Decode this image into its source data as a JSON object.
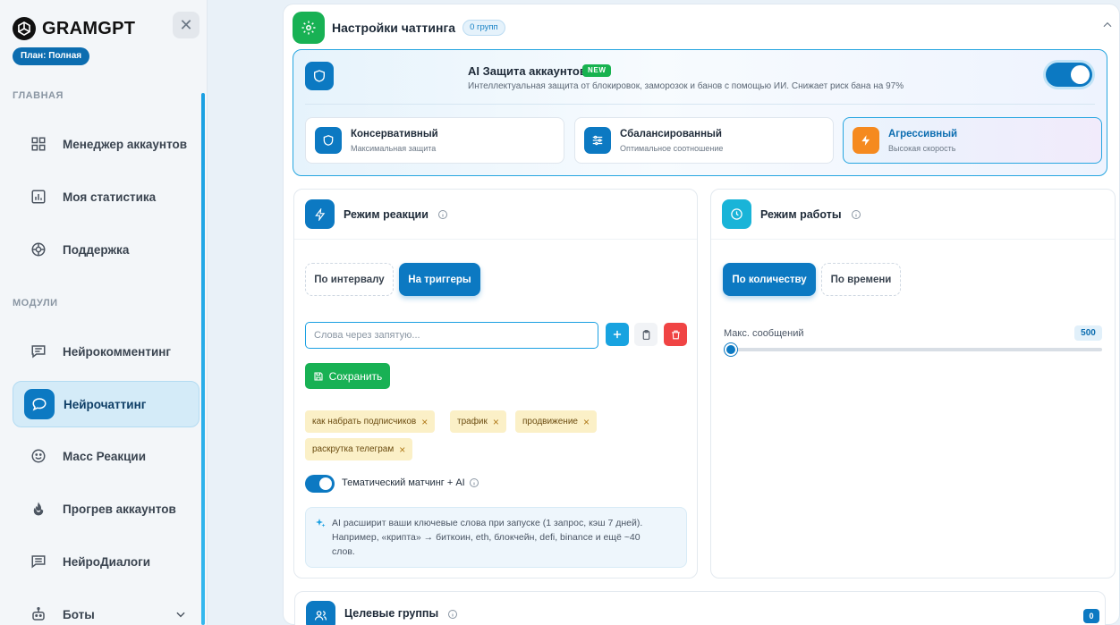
{
  "brand": {
    "name": "GRAMGPT",
    "plan": "План: Полная"
  },
  "sidebar": {
    "sections": {
      "main": "ГЛАВНАЯ",
      "modules": "МОДУЛИ"
    },
    "items": [
      {
        "label": "Менеджер аккаунтов",
        "icon": "grid-icon"
      },
      {
        "label": "Моя статистика",
        "icon": "chart-icon"
      },
      {
        "label": "Поддержка",
        "icon": "lifebuoy-icon"
      },
      {
        "label": "Нейрокомментинг",
        "icon": "comment-icon"
      },
      {
        "label": "Нейрочаттинг",
        "icon": "chat-icon",
        "active": true
      },
      {
        "label": "Масс Реакции",
        "icon": "smile-icon"
      },
      {
        "label": "Прогрев аккаунтов",
        "icon": "fire-icon"
      },
      {
        "label": "НейроДиалоги",
        "icon": "dialog-icon"
      },
      {
        "label": "Боты",
        "icon": "bot-icon"
      }
    ]
  },
  "panel": {
    "title": "Настройки чаттинга",
    "badge": "0 групп"
  },
  "ai_protection": {
    "title": "AI Защита аккаунтов",
    "new_badge": "NEW",
    "description": "Интеллектуальная защита от блокировок, заморозок и банов с помощью ИИ. Снижает риск бана на 97%",
    "enabled": true,
    "modes": [
      {
        "title": "Консервативный",
        "subtitle": "Максимальная защита",
        "color": "#0c79c2"
      },
      {
        "title": "Сбалансированный",
        "subtitle": "Оптимальное соотношение",
        "color": "#0c79c2"
      },
      {
        "title": "Агрессивный",
        "subtitle": "Высокая скорость",
        "color": "#f58a1f",
        "selected": true
      }
    ]
  },
  "reaction": {
    "title": "Режим реакции",
    "tabs": [
      "По интервалу",
      "На триггеры"
    ],
    "active_tab": "На триггеры",
    "input_placeholder": "Слова через запятую...",
    "save_label": "Сохранить",
    "tags": [
      "как набрать подписчиков",
      "трафик",
      "продвижение",
      "раскрутка телеграм"
    ],
    "toggle_label": "Тематический матчинг + AI",
    "toggle_on": true,
    "hint_lines": [
      "AI расширит ваши ключевые слова при запуске (1 запрос, кэш 7 дней).",
      "Например, «крипта» → биткоин, eth, блокчейн, defi, binance и ещё ~40",
      "слов."
    ]
  },
  "work": {
    "title": "Режим работы",
    "tabs": [
      "По количеству",
      "По времени"
    ],
    "active_tab": "По количеству",
    "slider_label": "Макс. сообщений",
    "slider_value": "500",
    "slider_fraction": 0.02
  },
  "targets": {
    "title": "Целевые группы",
    "count": "0"
  },
  "colors": {
    "accent": "#0c79c2",
    "success": "#18b154",
    "danger": "#f04444",
    "warning": "#f58a1f"
  }
}
